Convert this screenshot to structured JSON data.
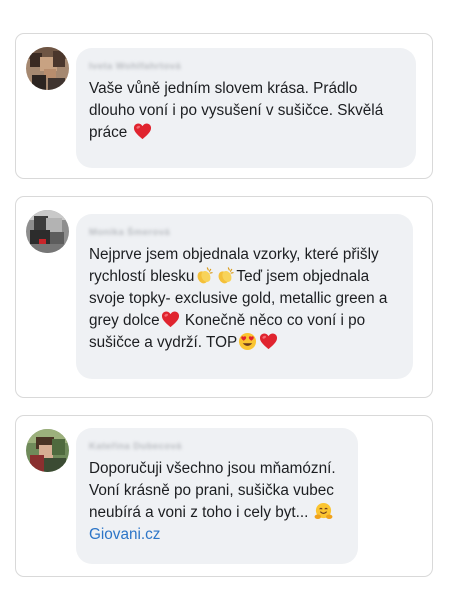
{
  "comments": [
    {
      "author": "Iveta Wohlfahrtová",
      "parts": [
        "Vaše vůně jedním slovem krása. Prádlo dlouho voní i po vysušení v sušičce. Skvělá práce "
      ],
      "icons": [
        "red-heart-icon"
      ]
    },
    {
      "author": "Monika Šmerová",
      "parts": [
        "Nejprve jsem objednala vzorky, které přišly rychlostí blesku",
        "Teď jsem objednala svoje topky- exclusive gold, metallic green a grey dolce",
        " Konečně něco co voní i po sušičce a vydrží. TOP"
      ],
      "icons": [
        "clapping-hands-icon",
        "red-heart-icon",
        "heart-eyes-face-icon"
      ]
    },
    {
      "author": "Kateřina Dubecová",
      "parts": [
        "Doporučuji všechno jsou mňamózní. Voní krásně po prani, sušička vubec neubírá a voni z toho i cely byt... "
      ],
      "icons": [
        "hugging-face-icon"
      ],
      "link": "Giovani.cz"
    }
  ],
  "colors": {
    "card_border": "#d9d9d9",
    "bubble_bg": "#eff1f4",
    "text": "#1c1e21",
    "link": "#2c75c7"
  }
}
